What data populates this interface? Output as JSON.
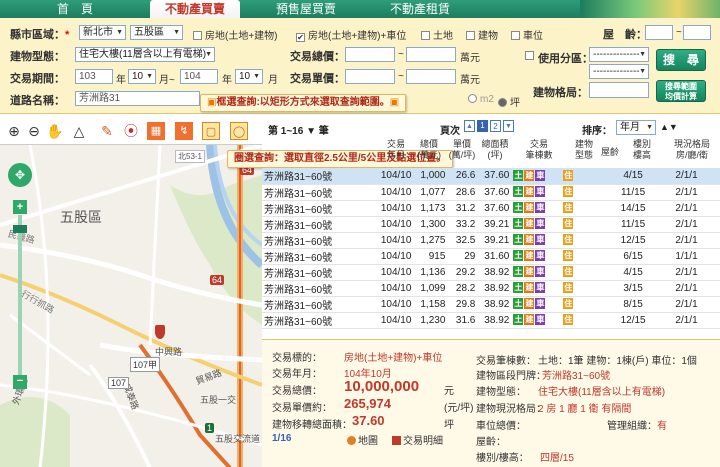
{
  "nav": {
    "tabs": [
      "首　頁",
      "不動產買賣",
      "預售屋買賣",
      "不動產租賃"
    ],
    "active_index": 1
  },
  "filter": {
    "county_label": "縣市區域：",
    "county_value": "新北市",
    "district_value": "五股區",
    "checkbox_land_building": "房地(土地+建物)",
    "checkbox_land_building_parking": "房地(土地+建物)+車位",
    "checkbox_land": "土地",
    "checkbox_building": "建物",
    "checkbox_parking": "車位",
    "house_age_label": "屋　齡：",
    "house_age_sep": "~",
    "building_type_label": "建物型態：",
    "building_type_value": "住宅大樓(11層含以上有電梯)",
    "total_price_label": "交易總價：",
    "total_price_unit": "萬元",
    "range_sep": "~",
    "use_zone_label": "使用分區：",
    "use_zone_value": "--------------",
    "use_zone_value2": "--------------",
    "search_button": "搜　尋",
    "period_label": "交易期間：",
    "period_from_year": "103",
    "period_year_unit": "年",
    "period_from_month": "10",
    "period_month_unit": "月~",
    "period_to_year": "104",
    "period_to_year_unit": "年",
    "period_to_month": "10",
    "period_to_month_unit": "月",
    "unit_price_label": "交易單價：",
    "unit_price_unit": "萬元",
    "road_label": "道路名稱：",
    "road_value": "芳洲路31",
    "area_unit_m2": "m2",
    "area_unit_ping": "坪",
    "layout_label": "建物格局：",
    "avg_button_line1": "搜尋範圍",
    "avg_button_line2": "均價計算"
  },
  "tooltips": {
    "rect_select": "框選查詢:以矩形方式來選取查詢範圍。",
    "circle_select": "圈選查詢：選取直徑2.5公里/5公里及點選位置。"
  },
  "list": {
    "range_select": "第 1~16 ▼ 筆",
    "page_label": "頁次",
    "pages": [
      "▲",
      "1",
      "2",
      "▼"
    ],
    "sort_label": "排序：",
    "sort_value": "年月",
    "sort_arrows": "▲▼",
    "headers": [
      "交易\n年月",
      "總價\n(萬元)",
      "單價\n(萬/坪)",
      "總面積\n(坪)",
      "交易\n筆棟數",
      "建物\n型態",
      "屋齡",
      "樓別\n樓高",
      "現況格局\n房/廳/衛"
    ],
    "rows": [
      {
        "addr": "芳洲路31~60號",
        "ym": "104/10",
        "total": "1,000",
        "unit": "26.6",
        "area": "37.60",
        "type": "住",
        "age": "",
        "floor": "4/15",
        "layout": "2/1/1"
      },
      {
        "addr": "芳洲路31~60號",
        "ym": "104/10",
        "total": "1,077",
        "unit": "28.6",
        "area": "37.60",
        "type": "住",
        "age": "",
        "floor": "11/15",
        "layout": "2/1/1"
      },
      {
        "addr": "芳洲路31~60號",
        "ym": "104/10",
        "total": "1,173",
        "unit": "31.2",
        "area": "37.60",
        "type": "住",
        "age": "",
        "floor": "14/15",
        "layout": "2/1/1"
      },
      {
        "addr": "芳洲路31~60號",
        "ym": "104/10",
        "total": "1,300",
        "unit": "33.2",
        "area": "39.21",
        "type": "住",
        "age": "",
        "floor": "11/15",
        "layout": "2/1/1"
      },
      {
        "addr": "芳洲路31~60號",
        "ym": "104/10",
        "total": "1,275",
        "unit": "32.5",
        "area": "39.21",
        "type": "住",
        "age": "",
        "floor": "12/15",
        "layout": "2/1/1"
      },
      {
        "addr": "芳洲路31~60號",
        "ym": "104/10",
        "total": "915",
        "unit": "29",
        "area": "31.60",
        "type": "住",
        "age": "",
        "floor": "6/15",
        "layout": "1/1/1"
      },
      {
        "addr": "芳洲路31~60號",
        "ym": "104/10",
        "total": "1,136",
        "unit": "29.2",
        "area": "38.92",
        "type": "住",
        "age": "",
        "floor": "4/15",
        "layout": "2/1/1"
      },
      {
        "addr": "芳洲路31~60號",
        "ym": "104/10",
        "total": "1,099",
        "unit": "28.2",
        "area": "38.92",
        "type": "住",
        "age": "",
        "floor": "3/15",
        "layout": "2/1/1"
      },
      {
        "addr": "芳洲路31~60號",
        "ym": "104/10",
        "total": "1,158",
        "unit": "29.8",
        "area": "38.92",
        "type": "住",
        "age": "",
        "floor": "8/15",
        "layout": "2/1/1"
      },
      {
        "addr": "芳洲路31~60號",
        "ym": "104/10",
        "total": "1,230",
        "unit": "31.6",
        "area": "38.92",
        "type": "住",
        "age": "",
        "floor": "12/15",
        "layout": "2/1/1"
      }
    ],
    "badges": [
      "土",
      "建",
      "車"
    ]
  },
  "detail": {
    "target_label": "交易標的：",
    "target_value": "房地(土地+建物)+車位",
    "ym_label": "交易年月：",
    "ym_value": "104年10月",
    "total_label": "交易總價：",
    "total_value": "10,000,000",
    "total_unit": "元",
    "unit_label": "交易單價約：",
    "unit_value": "265,974",
    "unit_unit": "(元/坪)",
    "area_label": "建物移轉總面積：",
    "area_value": "37.60",
    "area_unit": "坪",
    "index": "1/16",
    "map_link": "地圖",
    "detail_link": "交易明細",
    "count_label": "交易筆棟數：",
    "count_value": "土地：1筆 建物：1棟(戶) 車位：1個",
    "door_label": "建物區段門牌：",
    "door_value": "芳洲路31~60號",
    "btype_label": "建物型態：",
    "btype_value": "住宅大樓(11層含以上有電梯)",
    "layout_label": "建物現況格局：",
    "layout_value": "2 房 1 廳 1 衛 有隔間",
    "parking_label": "車位總價：",
    "mgmt_label": "管理組織：",
    "mgmt_value": "有",
    "age_label": "屋齡：",
    "floor_label": "樓別/樓高：",
    "floor_value": "四層/15"
  },
  "map": {
    "district": "五股區",
    "road1": "民義路",
    "road2": "成泰路",
    "road3": "中興路",
    "road4": "五股一交",
    "road5": "五股交流道",
    "road6": "五股一交",
    "shield1": "64",
    "shield2": "64",
    "shield3": "1",
    "shield4": "107",
    "shield5": "107甲",
    "label_left": "外環道",
    "label_mid": "貿易路",
    "label_top": "北53-1",
    "label_elev": "高架道路",
    "label_xing": "行行抓路",
    "label_chengtai": "成泰路"
  }
}
